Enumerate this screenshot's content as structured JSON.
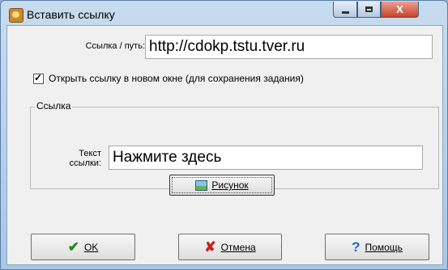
{
  "window": {
    "title": "Вставить ссылку",
    "controls": {
      "minimize": "minimize",
      "maximize": "maximize",
      "close": "X"
    }
  },
  "form": {
    "path_label": "Ссылка / путь:",
    "path_value": "http://cdokp.tstu.tver.ru",
    "new_window_checked": true,
    "new_window_label": "Открыть ссылку в новом окне (для сохранения задания)",
    "group_title": "Ссылка",
    "link_text_label_line1": "Текст",
    "link_text_label_line2": "ссылки:",
    "link_text_value": "Нажмите здесь",
    "picture_button_label": "Рисунок"
  },
  "buttons": {
    "ok_label": "OK",
    "cancel_label": "Отмена",
    "help_label": "Помощь"
  },
  "icons": {
    "app": "app-icon",
    "picture": "picture-icon",
    "ok": "checkmark-icon",
    "cancel": "cross-icon",
    "help": "question-icon"
  }
}
